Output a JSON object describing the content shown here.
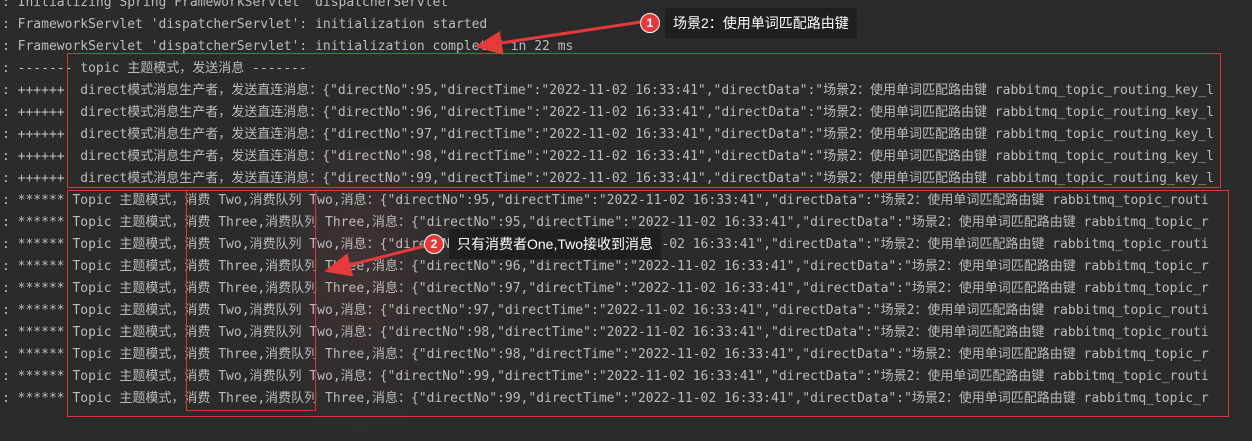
{
  "log_lines": [
    ": Initializing Spring FrameworkServlet 'dispatcherServlet'",
    ": FrameworkServlet 'dispatcherServlet': initialization started",
    ": FrameworkServlet 'dispatcherServlet': initialization completed in 22 ms",
    ": ------- topic 主题模式，发送消息 -------",
    ": ++++++  direct模式消息生产者，发送直连消息：{\"directNo\":95,\"directTime\":\"2022-11-02 16:33:41\",\"directData\":\"场景2：使用单词匹配路由键 rabbitmq_topic_routing_key_l",
    ": ++++++  direct模式消息生产者，发送直连消息：{\"directNo\":96,\"directTime\":\"2022-11-02 16:33:41\",\"directData\":\"场景2：使用单词匹配路由键 rabbitmq_topic_routing_key_l",
    ": ++++++  direct模式消息生产者，发送直连消息：{\"directNo\":97,\"directTime\":\"2022-11-02 16:33:41\",\"directData\":\"场景2：使用单词匹配路由键 rabbitmq_topic_routing_key_l",
    ": ++++++  direct模式消息生产者，发送直连消息：{\"directNo\":98,\"directTime\":\"2022-11-02 16:33:41\",\"directData\":\"场景2：使用单词匹配路由键 rabbitmq_topic_routing_key_l",
    ": ++++++  direct模式消息生产者，发送直连消息：{\"directNo\":99,\"directTime\":\"2022-11-02 16:33:41\",\"directData\":\"场景2：使用单词匹配路由键 rabbitmq_topic_routing_key_l",
    ": ****** Topic 主题模式，消费 Two,消费队列 Two,消息：{\"directNo\":95,\"directTime\":\"2022-11-02 16:33:41\",\"directData\":\"场景2：使用单词匹配路由键 rabbitmq_topic_routi",
    ": ****** Topic 主题模式，消费 Three,消费队列 Three,消息：{\"directNo\":95,\"directTime\":\"2022-11-02 16:33:41\",\"directData\":\"场景2：使用单词匹配路由键 rabbitmq_topic_r",
    ": ****** Topic 主题模式，消费 Two,消费队列 Two,消息：{\"directNo\":96,\"directTime\":\"2022-11-02 16:33:41\",\"directData\":\"场景2：使用单词匹配路由键 rabbitmq_topic_routi",
    ": ****** Topic 主题模式，消费 Three,消费队列 Three,消息：{\"directNo\":96,\"directTime\":\"2022-11-02 16:33:41\",\"directData\":\"场景2：使用单词匹配路由键 rabbitmq_topic_r",
    ": ****** Topic 主题模式，消费 Three,消费队列 Three,消息：{\"directNo\":97,\"directTime\":\"2022-11-02 16:33:41\",\"directData\":\"场景2：使用单词匹配路由键 rabbitmq_topic_r",
    ": ****** Topic 主题模式，消费 Two,消费队列 Two,消息：{\"directNo\":97,\"directTime\":\"2022-11-02 16:33:41\",\"directData\":\"场景2：使用单词匹配路由键 rabbitmq_topic_routi",
    ": ****** Topic 主题模式，消费 Two,消费队列 Two,消息：{\"directNo\":98,\"directTime\":\"2022-11-02 16:33:41\",\"directData\":\"场景2：使用单词匹配路由键 rabbitmq_topic_routi",
    ": ****** Topic 主题模式，消费 Three,消费队列 Three,消息：{\"directNo\":98,\"directTime\":\"2022-11-02 16:33:41\",\"directData\":\"场景2：使用单词匹配路由键 rabbitmq_topic_r",
    ": ****** Topic 主题模式，消费 Two,消费队列 Two,消息：{\"directNo\":99,\"directTime\":\"2022-11-02 16:33:41\",\"directData\":\"场景2：使用单词匹配路由键 rabbitmq_topic_routi",
    ": ****** Topic 主题模式，消费 Three,消费队列 Three,消息：{\"directNo\":99,\"directTime\":\"2022-11-02 16:33:41\",\"directData\":\"场景2：使用单词匹配路由键 rabbitmq_topic_r"
  ],
  "annotations": [
    {
      "number": "1",
      "text": "场景2：使用单词匹配路由键"
    },
    {
      "number": "2",
      "text": "只有消费者One,Two接收到消息"
    }
  ],
  "colors": {
    "background": "#2b2b2b",
    "log_text": "#bbbbbb",
    "highlight_box": "#d9363a",
    "badge": "#e5393c",
    "callout_background": "#1f1f1f"
  }
}
